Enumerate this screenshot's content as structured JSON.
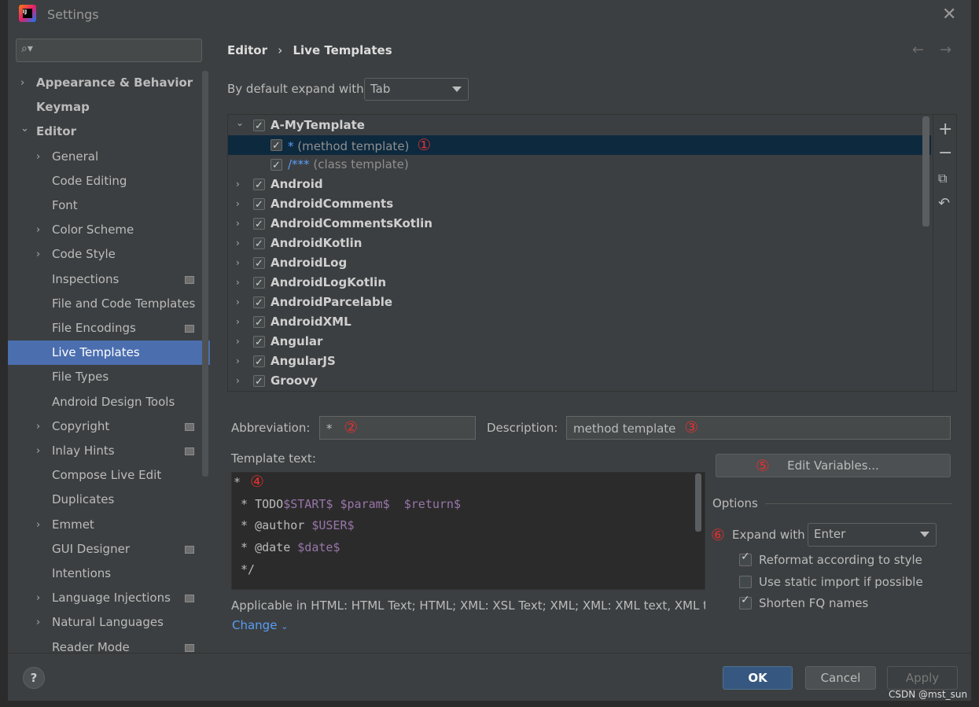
{
  "window": {
    "title": "Settings"
  },
  "search": {
    "placeholder": ""
  },
  "sidebar": {
    "items": [
      {
        "label": "Appearance & Behavior",
        "level": 0,
        "expander": "collapsed",
        "bold": true
      },
      {
        "label": "Keymap",
        "level": 0,
        "expander": "none",
        "bold": true
      },
      {
        "label": "Editor",
        "level": 0,
        "expander": "expanded",
        "bold": true
      },
      {
        "label": "General",
        "level": 1,
        "expander": "collapsed"
      },
      {
        "label": "Code Editing",
        "level": 1,
        "expander": "none"
      },
      {
        "label": "Font",
        "level": 1,
        "expander": "none"
      },
      {
        "label": "Color Scheme",
        "level": 1,
        "expander": "collapsed"
      },
      {
        "label": "Code Style",
        "level": 1,
        "expander": "collapsed"
      },
      {
        "label": "Inspections",
        "level": 1,
        "expander": "none",
        "project": true
      },
      {
        "label": "File and Code Templates",
        "level": 1,
        "expander": "none"
      },
      {
        "label": "File Encodings",
        "level": 1,
        "expander": "none",
        "project": true
      },
      {
        "label": "Live Templates",
        "level": 1,
        "expander": "none",
        "selected": true
      },
      {
        "label": "File Types",
        "level": 1,
        "expander": "none"
      },
      {
        "label": "Android Design Tools",
        "level": 1,
        "expander": "none"
      },
      {
        "label": "Copyright",
        "level": 1,
        "expander": "collapsed",
        "project": true
      },
      {
        "label": "Inlay Hints",
        "level": 1,
        "expander": "collapsed",
        "project": true
      },
      {
        "label": "Compose Live Edit",
        "level": 1,
        "expander": "none"
      },
      {
        "label": "Duplicates",
        "level": 1,
        "expander": "none"
      },
      {
        "label": "Emmet",
        "level": 1,
        "expander": "collapsed"
      },
      {
        "label": "GUI Designer",
        "level": 1,
        "expander": "none",
        "project": true
      },
      {
        "label": "Intentions",
        "level": 1,
        "expander": "none"
      },
      {
        "label": "Language Injections",
        "level": 1,
        "expander": "collapsed",
        "project": true
      },
      {
        "label": "Natural Languages",
        "level": 1,
        "expander": "collapsed"
      },
      {
        "label": "Reader Mode",
        "level": 1,
        "expander": "none",
        "project": true
      }
    ]
  },
  "breadcrumb": {
    "parent": "Editor",
    "sep": "›",
    "current": "Live Templates"
  },
  "expand_default": {
    "label": "By default expand with",
    "value": "Tab"
  },
  "templates": [
    {
      "name": "A-MyTemplate",
      "group": true,
      "expanded": true,
      "checked": true
    },
    {
      "abbr": "*",
      "desc": "(method template)",
      "group": false,
      "checked": true,
      "selected": true,
      "marker": "①"
    },
    {
      "abbr": "/***",
      "desc": "(class template)",
      "group": false,
      "checked": true
    },
    {
      "name": "Android",
      "group": true,
      "checked": true
    },
    {
      "name": "AndroidComments",
      "group": true,
      "checked": true
    },
    {
      "name": "AndroidCommentsKotlin",
      "group": true,
      "checked": true
    },
    {
      "name": "AndroidKotlin",
      "group": true,
      "checked": true
    },
    {
      "name": "AndroidLog",
      "group": true,
      "checked": true
    },
    {
      "name": "AndroidLogKotlin",
      "group": true,
      "checked": true
    },
    {
      "name": "AndroidParcelable",
      "group": true,
      "checked": true
    },
    {
      "name": "AndroidXML",
      "group": true,
      "checked": true
    },
    {
      "name": "Angular",
      "group": true,
      "checked": true
    },
    {
      "name": "AngularJS",
      "group": true,
      "checked": true
    },
    {
      "name": "Groovy",
      "group": true,
      "checked": true
    }
  ],
  "side_tools": [
    "plus-icon",
    "minus-icon",
    "copy-icon",
    "undo-icon"
  ],
  "abbreviation": {
    "label": "Abbreviation:",
    "value": "*",
    "marker": "②"
  },
  "description": {
    "label": "Description:",
    "value": "method template",
    "marker": "③"
  },
  "template_text": {
    "label": "Template text:",
    "marker": "④",
    "lines": [
      [
        {
          "t": "*",
          "v": false
        }
      ],
      [
        {
          "t": " * TODO",
          "v": false
        },
        {
          "t": "$START$",
          "v": true
        },
        {
          "t": " ",
          "v": false
        },
        {
          "t": "$param$",
          "v": true
        },
        {
          "t": "  ",
          "v": false
        },
        {
          "t": "$return$",
          "v": true
        }
      ],
      [
        {
          "t": " * @author ",
          "v": false
        },
        {
          "t": "$USER$",
          "v": true
        }
      ],
      [
        {
          "t": " * @date ",
          "v": false
        },
        {
          "t": "$date$",
          "v": true
        }
      ],
      [
        {
          "t": " */",
          "v": false
        }
      ]
    ]
  },
  "edit_variables": {
    "label": "Edit Variables...",
    "marker": "⑤"
  },
  "applicable": {
    "text": "Applicable in HTML: HTML Text; HTML; XML: XSL Text; XML; XML: XML text, XML t",
    "change": "Change"
  },
  "options": {
    "title": "Options",
    "expand_with": {
      "label": "Expand with",
      "value": "Enter",
      "marker": "⑥"
    },
    "checkboxes": [
      {
        "label": "Reformat according to style",
        "checked": true
      },
      {
        "label": "Use static import if possible",
        "checked": false
      },
      {
        "label": "Shorten FQ names",
        "checked": true
      }
    ]
  },
  "buttons": {
    "help": "?",
    "ok": "OK",
    "cancel": "Cancel",
    "apply": "Apply"
  },
  "watermark": "CSDN @mst_sun",
  "colors": {
    "selection": "#4b6eaf",
    "tree_selection": "#0d293e",
    "variable": "#9876aa",
    "abbr": "#589df6",
    "marker": "#e03030"
  }
}
